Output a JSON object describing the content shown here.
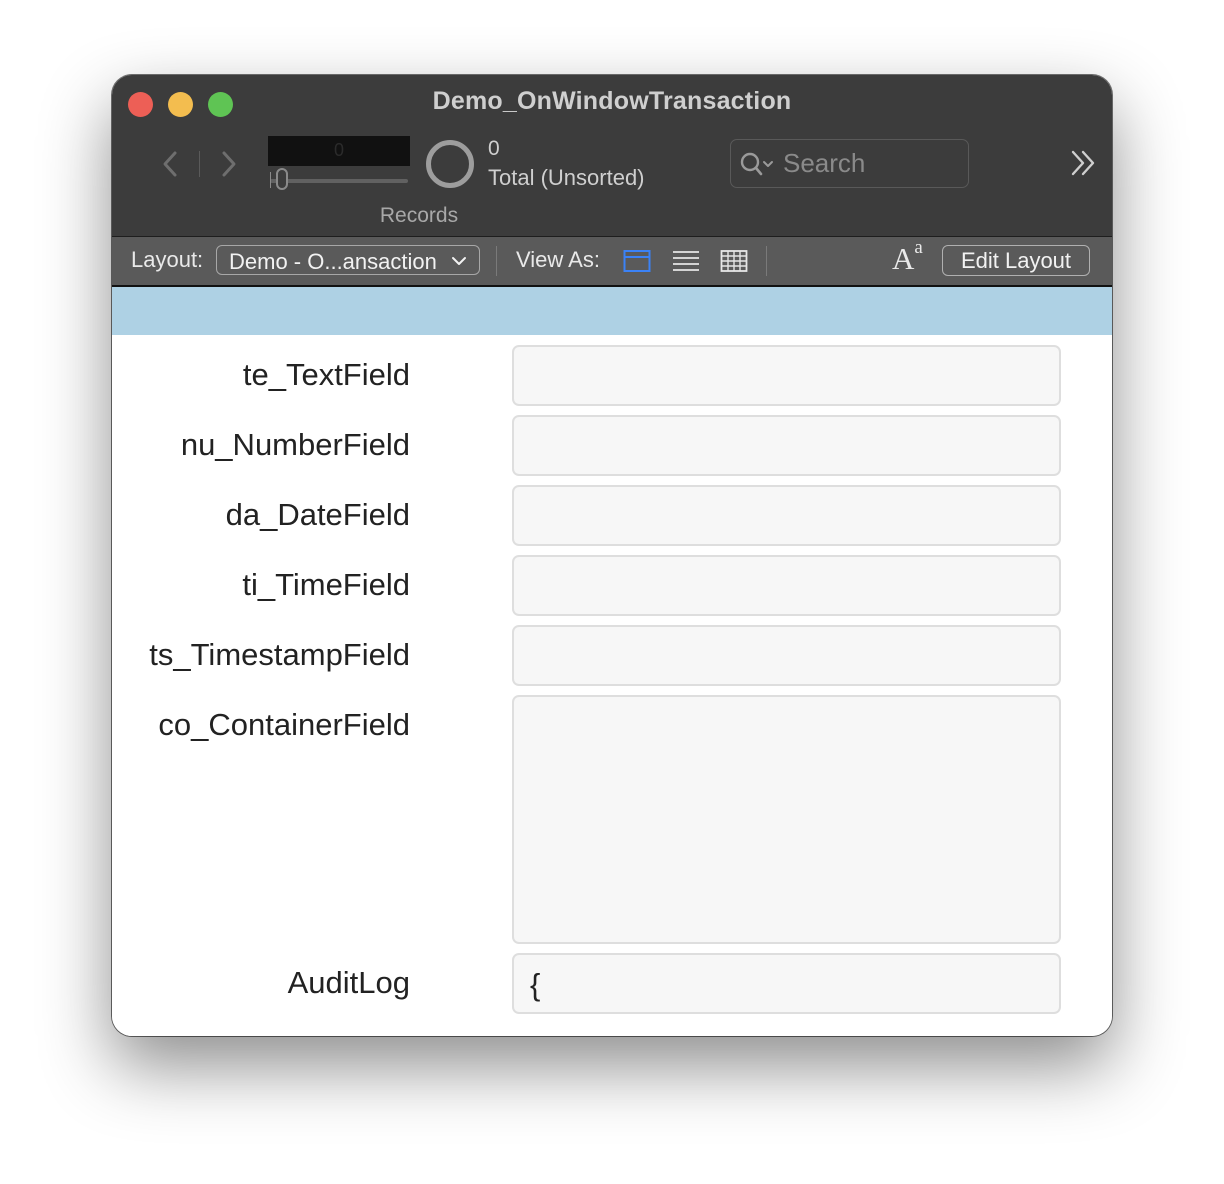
{
  "window": {
    "title": "Demo_OnWindowTransaction"
  },
  "toolbar": {
    "back_icon": "chevron-left-icon",
    "forward_icon": "chevron-right-icon",
    "current_record": "0",
    "records_label": "Records",
    "found_count": "0",
    "found_status": "Total (Unsorted)",
    "search_placeholder": "Search",
    "overflow_icon": "double-chevron-right-icon"
  },
  "layout_bar": {
    "layout_label": "Layout:",
    "layout_selected": "Demo - O...ansaction",
    "view_as_label": "View As:",
    "view_modes": [
      "form",
      "list",
      "table"
    ],
    "active_view": "form",
    "font_icon_main": "A",
    "font_icon_sup": "a",
    "edit_layout_label": "Edit Layout"
  },
  "colors": {
    "header_band": "#aed1e4",
    "active_view": "#3b82f6"
  },
  "fields": [
    {
      "label": "te_TextField",
      "value": ""
    },
    {
      "label": "nu_NumberField",
      "value": ""
    },
    {
      "label": "da_DateField",
      "value": ""
    },
    {
      "label": "ti_TimeField",
      "value": ""
    },
    {
      "label": "ts_TimestampField",
      "value": ""
    },
    {
      "label": "co_ContainerField",
      "value": ""
    },
    {
      "label": "AuditLog",
      "value": "{"
    }
  ]
}
